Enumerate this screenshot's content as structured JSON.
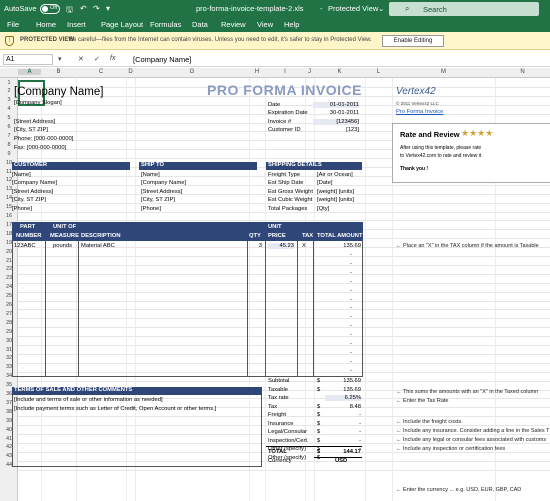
{
  "titlebar": {
    "autosave": "AutoSave",
    "toggle": "Off",
    "filename": "pro-forma-invoice-template-2.xls",
    "mode": "Protected View",
    "search": "Search"
  },
  "menu": [
    "File",
    "Home",
    "Insert",
    "Page Layout",
    "Formulas",
    "Data",
    "Review",
    "View",
    "Help"
  ],
  "protected": {
    "label": "PROTECTED VIEW",
    "message": "Be careful—files from the Internet can contain viruses. Unless you need to edit, it's safer to stay in Protected View.",
    "button": "Enable Editing"
  },
  "formula": {
    "namebox": "A1",
    "fx": "fx",
    "content": "[Company Name]"
  },
  "columns": [
    "A",
    "B",
    "C",
    "D",
    "G",
    "H",
    "I",
    "J",
    "K",
    "L",
    "M",
    "N"
  ],
  "rows": [
    "1",
    "2",
    "3",
    "4",
    "5",
    "6",
    "7",
    "8",
    "9",
    "10",
    "11",
    "12",
    "13",
    "14",
    "15",
    "16",
    "17",
    "18",
    "19",
    "20",
    "21",
    "22",
    "23",
    "24",
    "25",
    "26",
    "27",
    "28",
    "29",
    "30",
    "31",
    "32",
    "33",
    "34",
    "35",
    "36",
    "37",
    "38",
    "39",
    "40",
    "41",
    "42",
    "43",
    "44"
  ],
  "company": {
    "name": "[Company Name]",
    "slogan": "[Company Slogan]",
    "street": "[Street Address]",
    "city": "[City, ST  ZIP]",
    "phone": "Phone: [000-000-0000]",
    "fax": "Fax: [000-000-0000]"
  },
  "invoice": {
    "title": "PRO FORMA INVOICE",
    "date_label": "Date",
    "date": "01-01-2011",
    "exp_label": "Expiration Date",
    "exp": "30-01-2011",
    "num_label": "Invoice #",
    "num": "[123456]",
    "cust_label": "Customer ID",
    "cust": "[123]"
  },
  "vertex": {
    "logo": "Vertex42",
    "copyright": "© 2011 Vertex42 LLC",
    "link": "Pro Forma Invoice",
    "rate_title": "Rate and Review",
    "stars": "★★★★",
    "rate_text1": "After using this template, please rate",
    "rate_text2": "to Vertex42.com to rate and review it",
    "thanks": "Thank you !"
  },
  "customer": {
    "header": "CUSTOMER",
    "name": "[Name]",
    "company": "[Company Name]",
    "street": "[Street Address]",
    "city": "[City, ST  ZIP]",
    "phone": "[Phone]"
  },
  "shipto": {
    "header": "SHIP TO",
    "name": "[Name]",
    "company": "[Company Name]",
    "street": "[Street Address]",
    "city": "[City, ST  ZIP]",
    "phone": "[Phone]"
  },
  "shipping": {
    "header": "SHIPPING DETAILS",
    "rows": [
      [
        "Freight Type",
        "[Air or Ocean]"
      ],
      [
        "Est Ship Date",
        "[Date]"
      ],
      [
        "Est Gross Weight",
        "[weight] [units]"
      ],
      [
        "Est Cubic Weight",
        "[weight] [units]"
      ],
      [
        "Total Packages",
        "[Qty]"
      ]
    ]
  },
  "items_header": {
    "part1": "PART",
    "part2": "NUMBER",
    "unit1": "UNIT OF",
    "unit2": "MEASURE",
    "desc": "DESCRIPTION",
    "qty": "QTY",
    "uprice1": "UNIT",
    "uprice2": "PRICE",
    "tax": "TAX",
    "total": "TOTAL AMOUNT"
  },
  "item": {
    "part": "123ABC",
    "unit": "pounds",
    "desc": "Material ABC",
    "qty": "3",
    "price": "45.23",
    "tax": "X",
    "total": "135.69"
  },
  "dash": "-",
  "terms": {
    "header": "TERMS OF SALE AND OTHER COMMENTS",
    "line1": "[Include and terms of sale or other information as needed]",
    "line2": "[Include payment terms such as Letter of Credit, Open Account or other terms.]"
  },
  "summary": [
    [
      "Subtotal",
      "$",
      "135.69"
    ],
    [
      "Taxable",
      "$",
      "135.69"
    ],
    [
      "Tax rate",
      "",
      "6.25%"
    ],
    [
      "Tax",
      "$",
      "8.48"
    ],
    [
      "Freight",
      "$",
      "-"
    ],
    [
      "Insurance",
      "$",
      "-"
    ],
    [
      "Legal/Consular",
      "$",
      "-"
    ],
    [
      "Inspection/Cert.",
      "$",
      "-"
    ],
    [
      "Other (specify)",
      "$",
      "-"
    ],
    [
      "Other (specify)",
      "$",
      "-"
    ]
  ],
  "total": {
    "label": "TOTAL",
    "currency_sym": "$",
    "value": "144.17",
    "cur_label": "Currency",
    "cur_value": "USD"
  },
  "notes": {
    "tax_col": "← Place an \"X\" in the TAX column if the amount is Taxable",
    "sum": "← This sums the amounts with an \"X\" in the Taxed column",
    "rate": "← Enter the Tax Rate",
    "freight": "← Include the freight costs.",
    "insurance": "← Include any insurance. Consider adding a line in the Sales T",
    "legal": "← Include any legal or consular fees associated with customs",
    "inspection": "← Include any inspection or certification fees",
    "currency": "← Enter the currency ... e.g. USD, EUR, GBP, CAD"
  }
}
